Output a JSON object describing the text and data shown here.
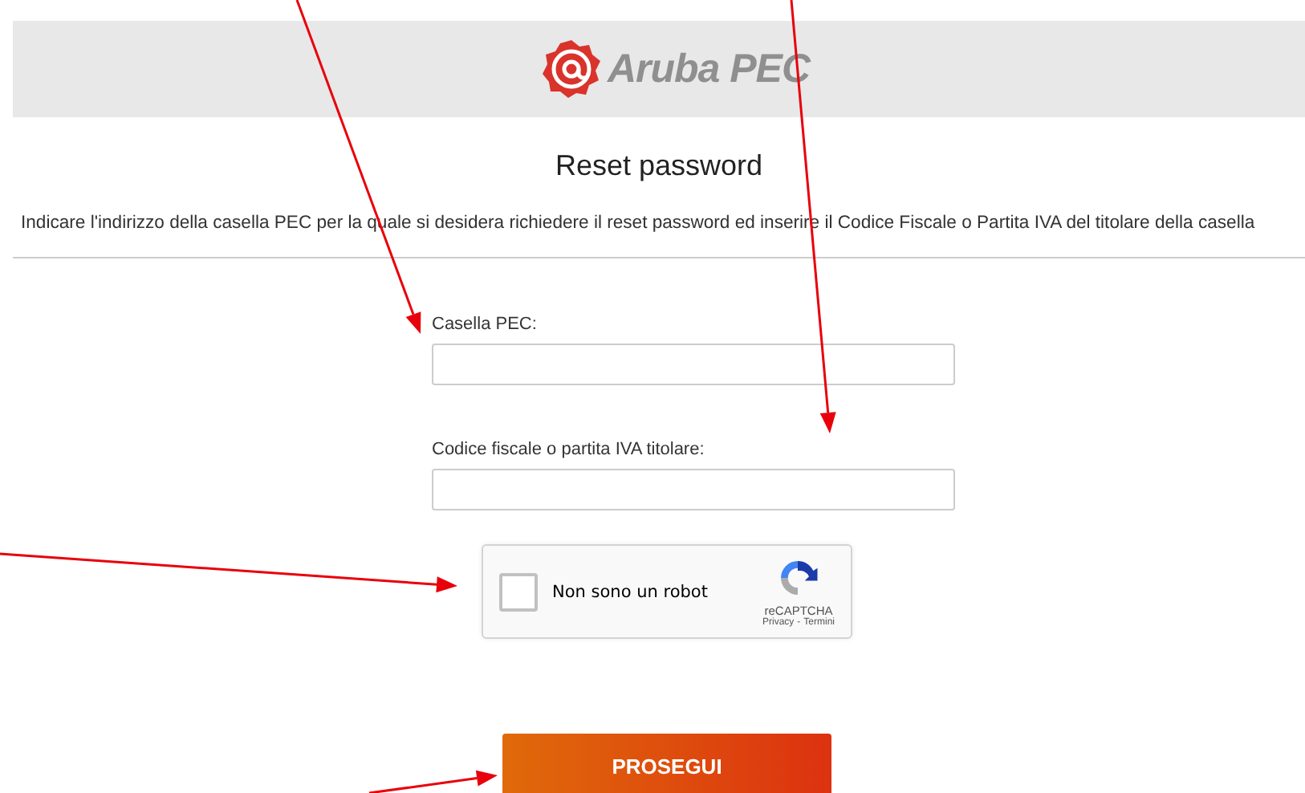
{
  "header": {
    "logo_text": "Aruba PEC"
  },
  "title": "Reset password",
  "description": "Indicare l'indirizzo della casella PEC per la quale si desidera richiedere il reset password ed inserire il Codice Fiscale o Partita IVA del titolare della casella",
  "fields": [
    {
      "label": "Casella PEC:"
    },
    {
      "label": "Codice fiscale o partita IVA titolare:"
    }
  ],
  "captcha": {
    "label": "Non sono un robot",
    "checked": false,
    "brand": "reCAPTCHA",
    "links": [
      "Privacy",
      "Termini"
    ],
    "separator": "-"
  },
  "submit": "PROSEGUI"
}
